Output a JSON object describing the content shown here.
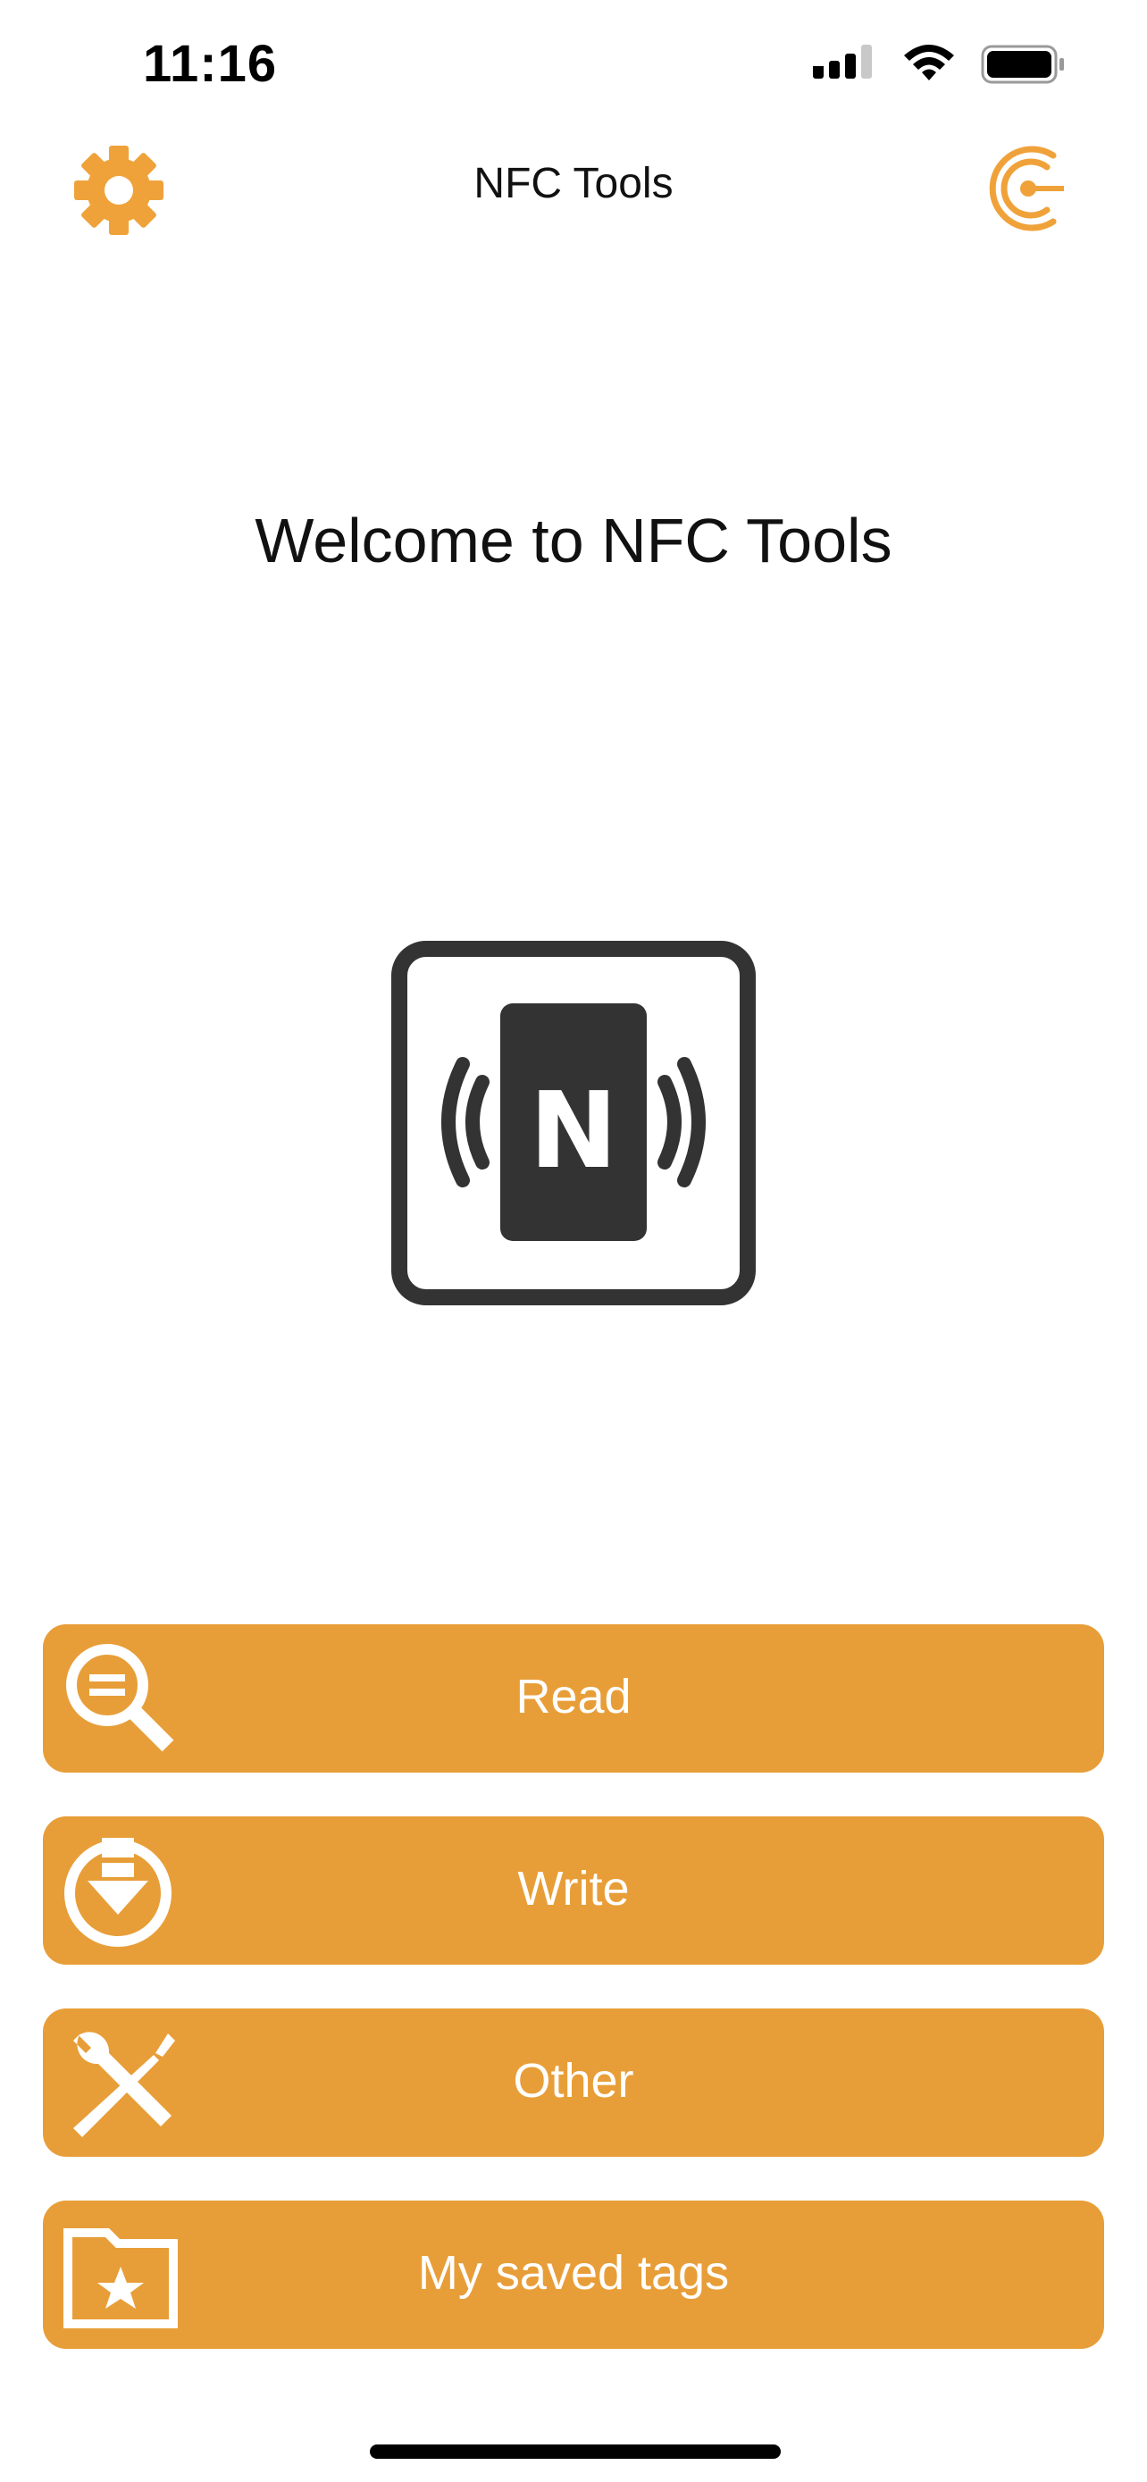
{
  "status_bar": {
    "time": "11:16"
  },
  "nav": {
    "title": "NFC Tools",
    "left_icon": "gear-icon",
    "right_icon": "coin-icon"
  },
  "welcome": {
    "text": "Welcome to NFC Tools"
  },
  "actions": [
    {
      "label": "Read",
      "icon": "read-magnifier-icon"
    },
    {
      "label": "Write",
      "icon": "write-download-icon"
    },
    {
      "label": "Other",
      "icon": "tools-icon"
    },
    {
      "label": "My saved tags",
      "icon": "folder-star-icon"
    }
  ],
  "colors": {
    "accent": "#e89e38",
    "logo": "#333333",
    "text": "#111111"
  }
}
